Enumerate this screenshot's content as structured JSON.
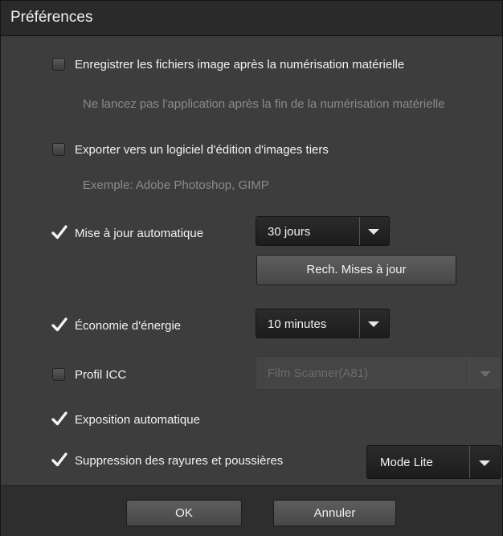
{
  "dialog": {
    "title": "Préférences"
  },
  "options": {
    "save_files": {
      "label": "Enregistrer les fichiers image après la numérisation matérielle",
      "checked": false
    },
    "save_files_hint": "Ne lancez pas l'application après la fin de la numérisation matérielle",
    "export": {
      "label": "Exporter vers un logiciel d'édition d'images tiers",
      "checked": false
    },
    "export_hint": "Exemple: Adobe Photoshop, GIMP",
    "auto_update": {
      "label": "Mise à jour automatique",
      "checked": true,
      "interval": "30 jours",
      "check_button": "Rech. Mises à jour"
    },
    "energy": {
      "label": "Économie d'énergie",
      "checked": true,
      "timeout": "10 minutes"
    },
    "icc": {
      "label": "Profil ICC",
      "checked": false,
      "profile": "Film Scanner(A81)"
    },
    "auto_exposure": {
      "label": "Exposition automatique",
      "checked": true
    },
    "dust": {
      "label": "Suppression des rayures et poussières",
      "checked": true,
      "mode": "Mode Lite"
    }
  },
  "footer": {
    "ok_label": "OK",
    "cancel_label": "Annuler"
  },
  "colors": {
    "background": "#3d3d3d",
    "titlebar": "#2a2a2a",
    "text": "#f2f2f2",
    "hint": "#8b8b8b"
  },
  "icons": {
    "checkmark": "checkmark-icon",
    "dropdown": "chevron-down-icon"
  }
}
